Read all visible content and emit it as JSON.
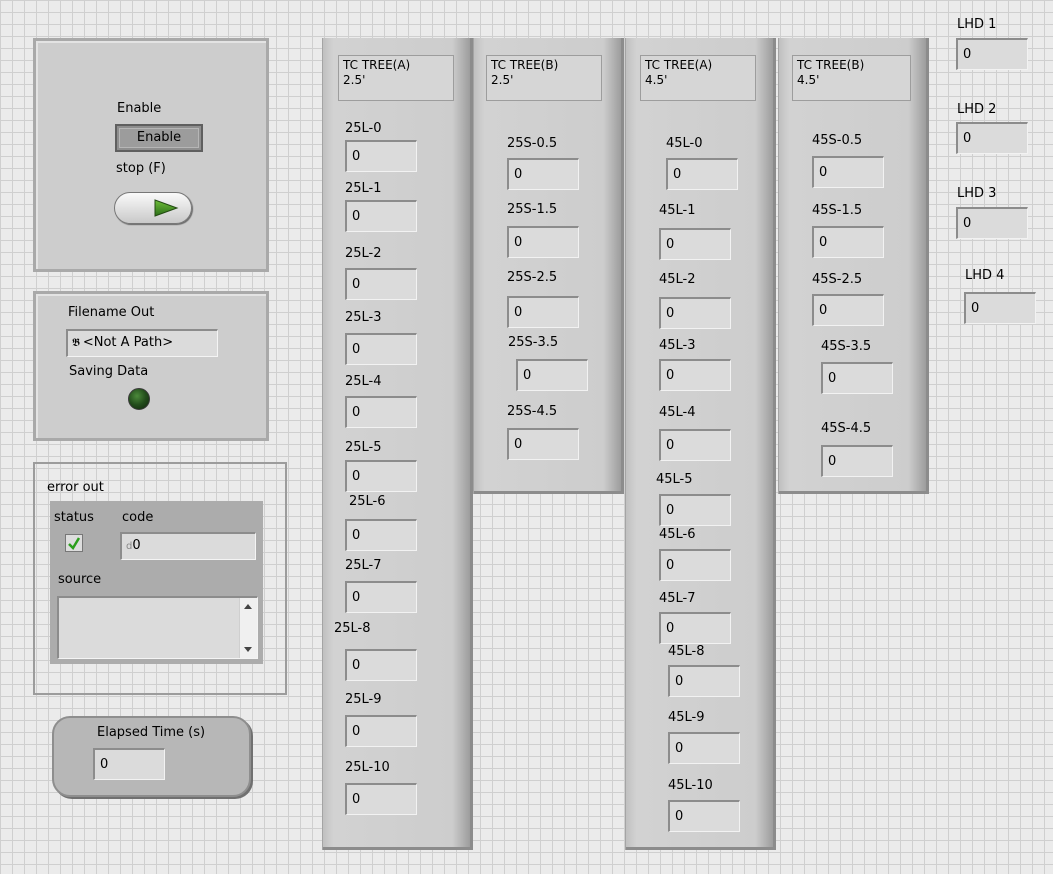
{
  "controls": {
    "enable_label": "Enable",
    "enable_button": "Enable",
    "stop_label": "stop (F)"
  },
  "file": {
    "filename_label": "Filename Out",
    "path_icon": "path-icon",
    "path_value": "<Not A Path>",
    "saving_label": "Saving Data"
  },
  "error_out": {
    "title": "error out",
    "status_label": "status",
    "code_label": "code",
    "code_value": "0",
    "source_label": "source",
    "source_value": ""
  },
  "elapsed": {
    "label": "Elapsed Time (s)",
    "value": "0"
  },
  "columns": [
    {
      "header": "TC TREE(A)\n2.5'",
      "sensors": [
        {
          "label": "25L-0",
          "value": "0"
        },
        {
          "label": "25L-1",
          "value": "0"
        },
        {
          "label": "25L-2",
          "value": "0"
        },
        {
          "label": "25L-3",
          "value": "0"
        },
        {
          "label": "25L-4",
          "value": "0"
        },
        {
          "label": "25L-5",
          "value": "0"
        },
        {
          "label": "25L-6",
          "value": "0"
        },
        {
          "label": "25L-7",
          "value": "0"
        },
        {
          "label": "25L-8",
          "value": "0"
        },
        {
          "label": "25L-9",
          "value": "0"
        },
        {
          "label": "25L-10",
          "value": "0"
        }
      ]
    },
    {
      "header": "TC TREE(B)\n2.5'",
      "sensors": [
        {
          "label": "25S-0.5",
          "value": "0"
        },
        {
          "label": "25S-1.5",
          "value": "0"
        },
        {
          "label": "25S-2.5",
          "value": "0"
        },
        {
          "label": "25S-3.5",
          "value": "0"
        },
        {
          "label": "25S-4.5",
          "value": "0"
        }
      ]
    },
    {
      "header": "TC TREE(A)\n4.5'",
      "sensors": [
        {
          "label": "45L-0",
          "value": "0"
        },
        {
          "label": "45L-1",
          "value": "0"
        },
        {
          "label": "45L-2",
          "value": "0"
        },
        {
          "label": "45L-3",
          "value": "0"
        },
        {
          "label": "45L-4",
          "value": "0"
        },
        {
          "label": "45L-5",
          "value": "0"
        },
        {
          "label": "45L-6",
          "value": "0"
        },
        {
          "label": "45L-7",
          "value": "0"
        },
        {
          "label": "45L-8",
          "value": "0"
        },
        {
          "label": "45L-9",
          "value": "0"
        },
        {
          "label": "45L-10",
          "value": "0"
        }
      ]
    },
    {
      "header": "TC TREE(B)\n4.5'",
      "sensors": [
        {
          "label": "45S-0.5",
          "value": "0"
        },
        {
          "label": "45S-1.5",
          "value": "0"
        },
        {
          "label": "45S-2.5",
          "value": "0"
        },
        {
          "label": "45S-3.5",
          "value": "0"
        },
        {
          "label": "45S-4.5",
          "value": "0"
        }
      ]
    }
  ],
  "lhd": [
    {
      "label": "LHD 1",
      "value": "0"
    },
    {
      "label": "LHD 2",
      "value": "0"
    },
    {
      "label": "LHD 3",
      "value": "0"
    },
    {
      "label": "LHD 4",
      "value": "0"
    }
  ]
}
